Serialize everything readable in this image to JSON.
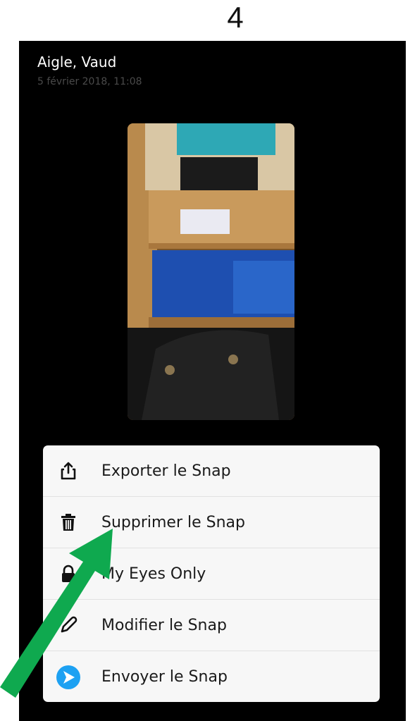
{
  "step_number": "4",
  "snap": {
    "location": "Aigle, Vaud",
    "datetime": "5 février 2018, 11:08"
  },
  "menu": {
    "items": [
      {
        "label": "Exporter le Snap",
        "icon": "share-icon"
      },
      {
        "label": "Supprimer le Snap",
        "icon": "trash-icon"
      },
      {
        "label": "My Eyes Only",
        "icon": "lock-icon"
      },
      {
        "label": "Modifier le Snap",
        "icon": "pencil-icon"
      },
      {
        "label": "Envoyer le Snap",
        "icon": "send-icon"
      }
    ]
  },
  "colors": {
    "send_accent": "#1da1f2",
    "arrow": "#0fa94f"
  }
}
